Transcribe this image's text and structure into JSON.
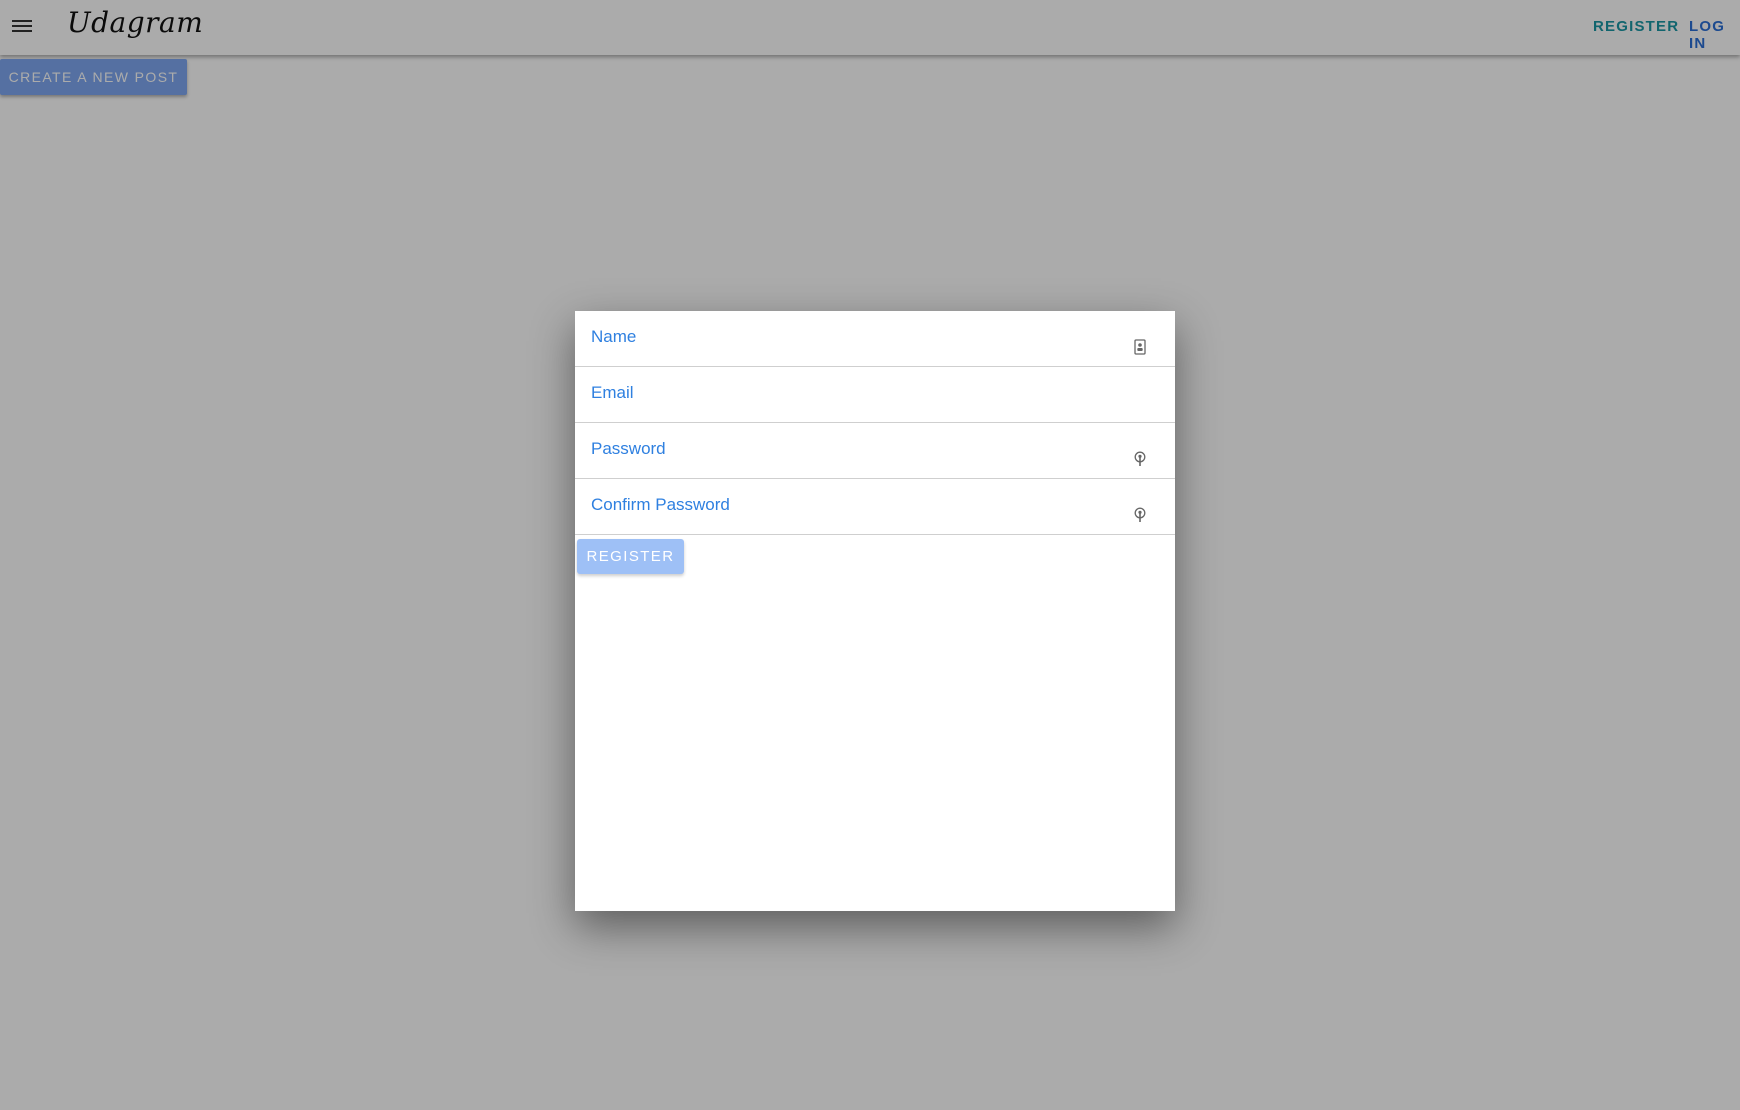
{
  "header": {
    "logo": "Udagram",
    "nav": {
      "register": "REGISTER",
      "login": "LOG IN"
    }
  },
  "toolbar": {
    "create_post_label": "CREATE A NEW POST"
  },
  "modal": {
    "fields": [
      {
        "label": "Name",
        "icon": "contact-card-icon"
      },
      {
        "label": "Email",
        "icon": ""
      },
      {
        "label": "Password",
        "icon": "password-key-icon"
      },
      {
        "label": "Confirm Password",
        "icon": "password-key-icon"
      }
    ],
    "submit_label": "REGISTER"
  },
  "colors": {
    "accent": "#2f80e0",
    "nav_register": "#1a97a5",
    "nav_login": "#2b6fd6",
    "button_disabled": "#9ec0f6",
    "backdrop": "rgba(0,0,0,0.33)"
  }
}
